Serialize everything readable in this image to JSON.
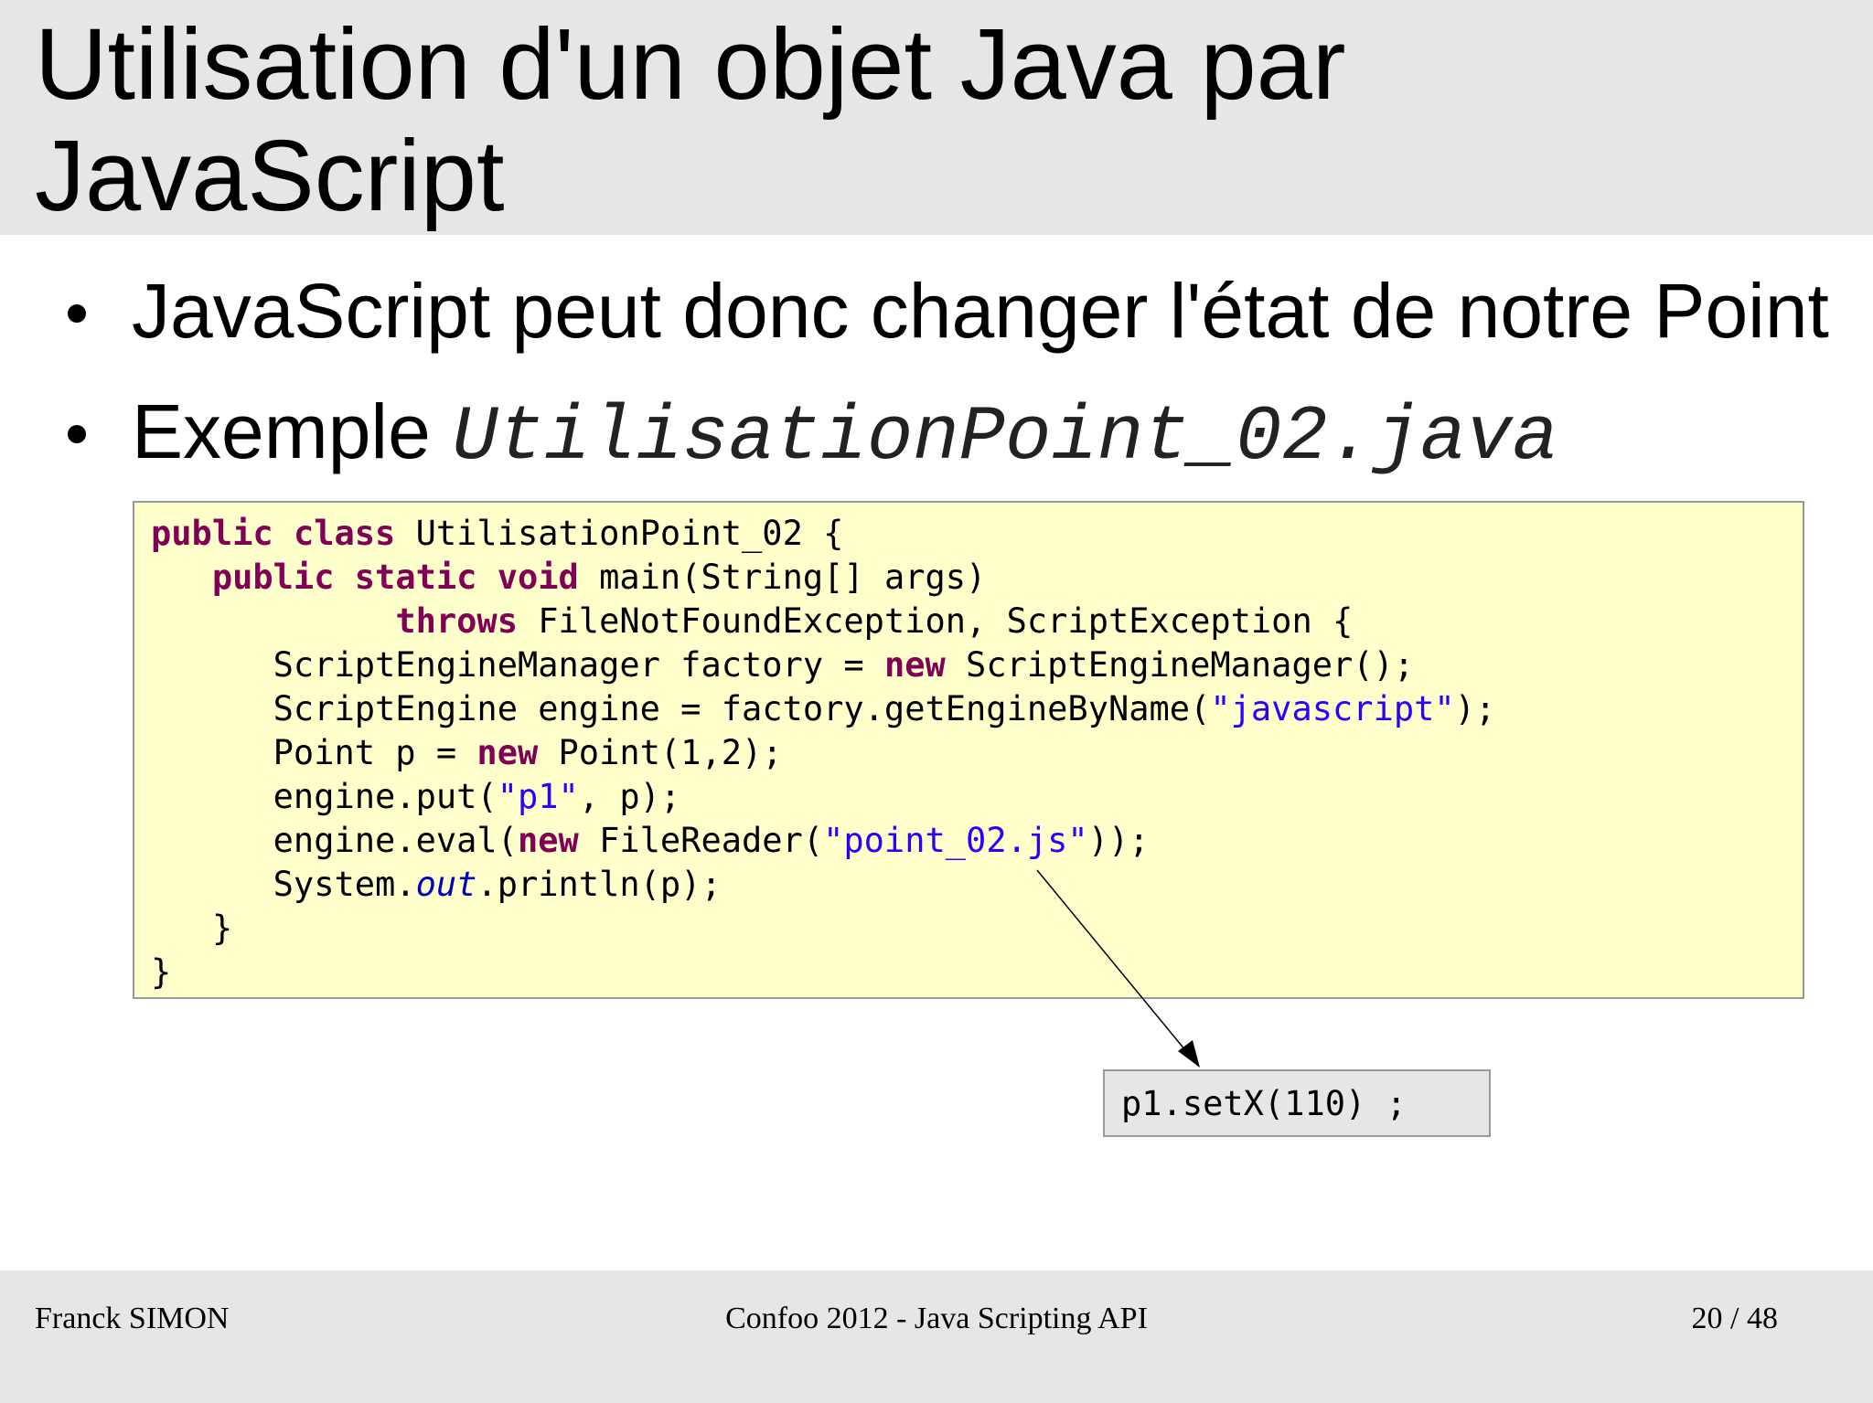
{
  "slide": {
    "title": "Utilisation d'un objet Java par\nJavaScript",
    "bullets": [
      {
        "text": "JavaScript peut donc changer l'état de notre Point"
      },
      {
        "text": "Exemple ",
        "code_ref": "UtilisationPoint_02.java"
      }
    ]
  },
  "code_block": {
    "lines": [
      [
        {
          "t": "public",
          "k": "kw"
        },
        {
          "t": " "
        },
        {
          "t": "class",
          "k": "kw"
        },
        {
          "t": " UtilisationPoint_02 {"
        }
      ],
      [
        {
          "t": "   "
        },
        {
          "t": "public",
          "k": "kw"
        },
        {
          "t": " "
        },
        {
          "t": "static",
          "k": "kw"
        },
        {
          "t": " "
        },
        {
          "t": "void",
          "k": "kw"
        },
        {
          "t": " main(String[] args)"
        }
      ],
      [
        {
          "t": "            "
        },
        {
          "t": "throws",
          "k": "kw"
        },
        {
          "t": " FileNotFoundException, ScriptException {"
        }
      ],
      [
        {
          "t": "      ScriptEngineManager factory = "
        },
        {
          "t": "new",
          "k": "kw"
        },
        {
          "t": " ScriptEngineManager();"
        }
      ],
      [
        {
          "t": "      ScriptEngine engine = factory.getEngineByName("
        },
        {
          "t": "\"javascript\"",
          "k": "str"
        },
        {
          "t": ");"
        }
      ],
      [
        {
          "t": "      Point p = "
        },
        {
          "t": "new",
          "k": "kw"
        },
        {
          "t": " Point(1,2);"
        }
      ],
      [
        {
          "t": "      engine.put("
        },
        {
          "t": "\"p1\"",
          "k": "str"
        },
        {
          "t": ", p);"
        }
      ],
      [
        {
          "t": "      engine.eval("
        },
        {
          "t": "new",
          "k": "kw"
        },
        {
          "t": " FileReader("
        },
        {
          "t": "\"point_02.js\"",
          "k": "str"
        },
        {
          "t": "));"
        }
      ],
      [
        {
          "t": "      System."
        },
        {
          "t": "out",
          "k": "fld"
        },
        {
          "t": ".println(p);"
        }
      ],
      [
        {
          "t": "   }"
        }
      ],
      [
        {
          "t": "}"
        }
      ]
    ]
  },
  "callout": {
    "text": "p1.setX(110) ;"
  },
  "footer": {
    "author": "Franck SIMON",
    "event": "Confoo 2012 - Java Scripting API",
    "page": "20 / 48"
  }
}
